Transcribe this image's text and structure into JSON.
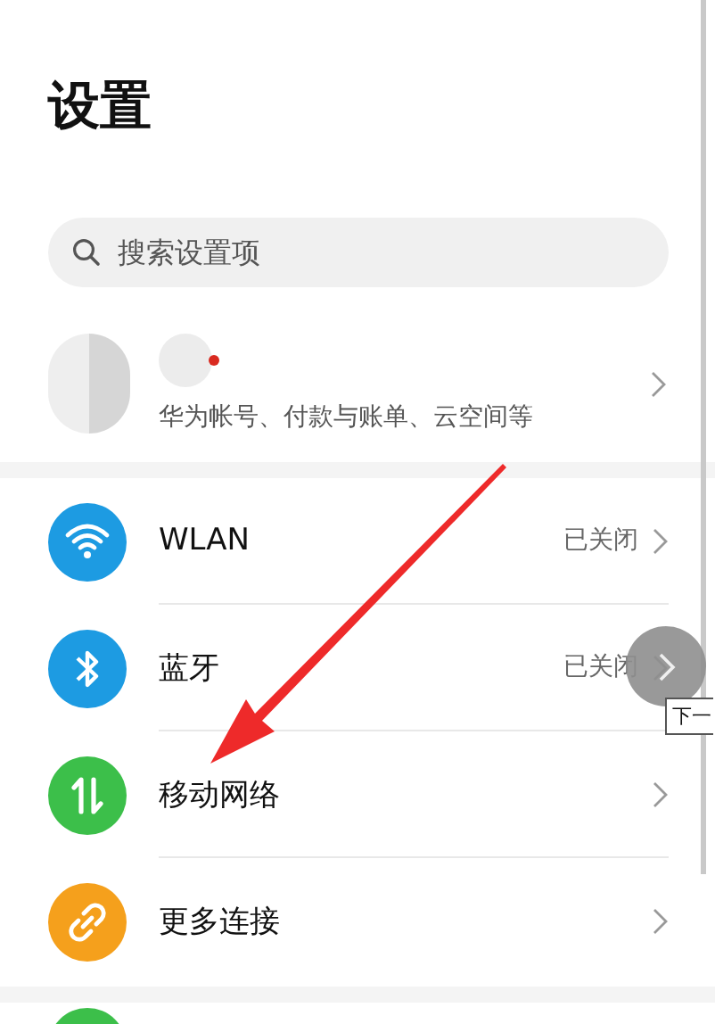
{
  "title": "设置",
  "search": {
    "placeholder": "搜索设置项"
  },
  "account": {
    "subtitle": "华为帐号、付款与账单、云空间等",
    "notification_dot": true
  },
  "items": [
    {
      "kind": "wifi",
      "label": "WLAN",
      "status": "已关闭",
      "color": "#1d9be2"
    },
    {
      "kind": "bluetooth",
      "label": "蓝牙",
      "status": "已关闭",
      "color": "#1d9be2"
    },
    {
      "kind": "mobile-data",
      "label": "移动网络",
      "color": "#3cbf4a"
    },
    {
      "kind": "link",
      "label": "更多连接",
      "color": "#f5a01c"
    }
  ],
  "next_button": {
    "tooltip": "下一"
  }
}
